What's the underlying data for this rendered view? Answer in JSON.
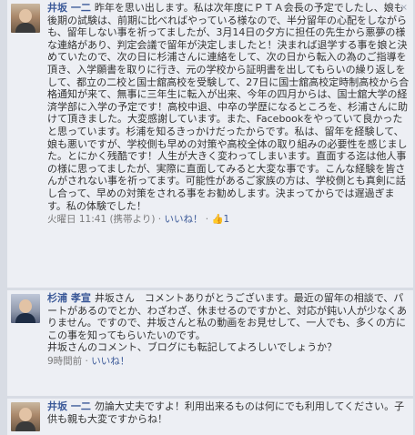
{
  "comments": [
    {
      "author": "井坂 一二",
      "text": "昨年を思い出します。私は次年度にＰＴＡ会長の予定でしたし、娘も後期の試験は、前期に比べればやっている様なので、半分留年の心配をしながらも、留年しない事を祈ってましたが、3月14日の夕方に担任の先生から悪夢の様な連絡があり、判定会議で留年が決定しましたと！決まれば退学する事を娘と決めていたので、次の日に杉浦さんに連絡をして、次の日から転入の為のご指導を頂き、入学願書を取りに行き、元の学校から証明書を出してもらいの繰り返しをして、都立の二校と国士舘高校を受験して、27日に国士舘高校定時制高校から合格通知が来て、無事に三年生に転入が出来、今年の四月からは、国士舘大学の経済学部に入学の予定です！高校中退、中卒の学歴になるところを、杉浦さんに助けて頂きました。大変感謝しています。また、Facebookをやっていて良かったと思っています。杉浦を知るきっかけだったからです。私は、留年を経験して、娘も悪いですが、学校側も早めの対策や高校全体の取り組みの必要性を感じました。とにかく残酷です！人生が大きく変わってしまいます。直面する迄は他人事の様に思ってましたが、実際に直面してみると大変な事です。こんな経験を皆さんがされない事を祈ってます。可能性があるご家族の方は、学校側とも真剣に話し合って、早めの対策をされる事をお勧めします。決まってからでは遅過ぎます。私の体験でした！",
      "time": "火曜日 11:41",
      "via": "(携帯より)",
      "like": "いいね！",
      "like_count": "1",
      "close": "×"
    },
    {
      "author": "杉浦 孝宣",
      "text": "井坂さん　コメントありがとうございます。最近の留年の相談で、パートがあるのでとか、わざわざ、休ませるのですかと、対応が鈍い人が少なくありません。ですので、井坂さんと私の動画をお見せして、一人でも、多くの方にこの事を知ってもらいたいのです。\n井坂さんのコメント、ブログにも転記してよろしいでしょうか？",
      "time": "9時間前",
      "like": "いいね！"
    },
    {
      "author": "井坂 一二",
      "text": "勿論大丈夫ですよ！利用出来るものは何にでも利用してください。子供も親も大変ですからね！"
    }
  ]
}
